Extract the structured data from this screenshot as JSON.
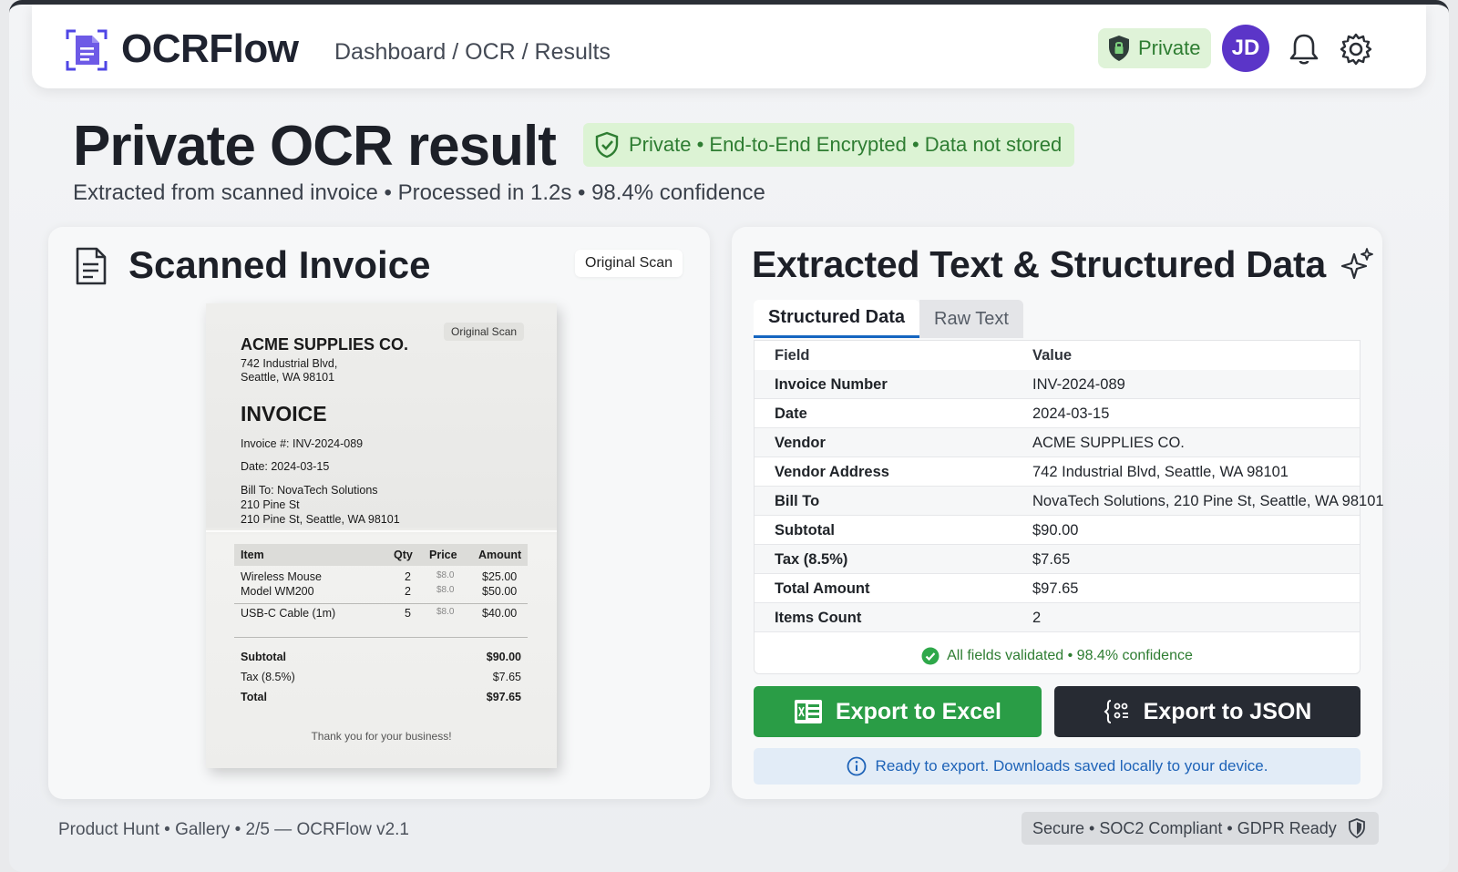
{
  "header": {
    "brand": "OCRFlow",
    "breadcrumb": "Dashboard / OCR / Results",
    "privacy_label": "Private",
    "avatar_initials": "JD",
    "icons": [
      "ocr-logo-icon",
      "shield-lock-icon",
      "bell-icon",
      "gear-icon"
    ]
  },
  "page": {
    "title": "Private OCR result",
    "encryption_badge": "Private • End-to-End Encrypted • Data not stored",
    "subtitle": "Extracted from scanned invoice • Processed in 1.2s • 98.4% confidence"
  },
  "scan_panel": {
    "title": "Scanned Invoice",
    "tag": "Original Scan",
    "invoice": {
      "tag": "Original Scan",
      "vendor": "ACME SUPPLIES CO.",
      "address_line1": "742 Industrial Blvd,",
      "address_line2": "Seattle, WA 98101",
      "heading": "INVOICE",
      "number": "Invoice #: INV-2024-089",
      "date": "Date: 2024-03-15",
      "bill_to_line1": "Bill To: NovaTech Solutions",
      "bill_to_line2": "210 Pine St",
      "bill_to_line3": "210 Pine St, Seattle, WA 98101",
      "columns": [
        "Item",
        "Qty",
        "Price",
        "Amount"
      ],
      "rows": [
        {
          "item": "Wireless Mouse",
          "qty": "2",
          "price": "$8.0",
          "amount": "$25.00"
        },
        {
          "item": "Model WM200",
          "qty": "2",
          "price": "$8.0",
          "amount": "$50.00"
        },
        {
          "item": "USB-C Cable (1m)",
          "qty": "5",
          "price": "$8.0",
          "amount": "$40.00"
        }
      ],
      "subtotal_label": "Subtotal",
      "subtotal": "$90.00",
      "tax_label": "Tax (8.5%)",
      "tax": "$7.65",
      "total_label": "Total",
      "total": "$97.65",
      "thanks": "Thank you for your business!"
    }
  },
  "data_panel": {
    "title": "Extracted Text & Structured Data",
    "tabs": [
      "Structured Data",
      "Raw Text"
    ],
    "columns": [
      "Field",
      "Value"
    ],
    "rows": [
      {
        "field": "Invoice Number",
        "value": "INV-2024-089"
      },
      {
        "field": "Date",
        "value": "2024-03-15"
      },
      {
        "field": "Vendor",
        "value": "ACME SUPPLIES CO."
      },
      {
        "field": "Vendor Address",
        "value": "742 Industrial Blvd, Seattle, WA 98101"
      },
      {
        "field": "Bill To",
        "value": "NovaTech Solutions, 210 Pine St, Seattle, WA 98101"
      },
      {
        "field": "Subtotal",
        "value": "$90.00"
      },
      {
        "field": "Tax (8.5%)",
        "value": "$7.65"
      },
      {
        "field": "Total Amount",
        "value": "$97.65"
      },
      {
        "field": "Items Count",
        "value": "2"
      }
    ],
    "validation": "All fields validated • 98.4% confidence",
    "export_excel": "Export to Excel",
    "export_json": "Export to JSON",
    "info": "Ready to export. Downloads saved locally to your device."
  },
  "footer": {
    "left": "Product Hunt • Gallery • 2/5 — OCRFlow v2.1",
    "right": "Secure • SOC2 Compliant • GDPR Ready"
  },
  "colors": {
    "accent_green": "#2a9d46",
    "dark_button": "#272b33",
    "tab_underline": "#1565c0",
    "avatar": "#5b35c8",
    "badge_green_bg": "#dcf3d4",
    "info_blue": "#1e63b8"
  }
}
